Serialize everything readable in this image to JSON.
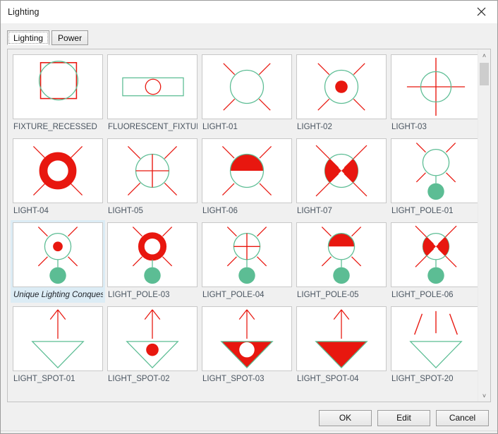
{
  "window": {
    "title": "Lighting",
    "close_icon": "close-icon"
  },
  "tabs": [
    {
      "label": "Lighting",
      "active": true
    },
    {
      "label": "Power",
      "active": false
    }
  ],
  "blocks": [
    {
      "name": "FIXTURE_RECESSED",
      "icon": "recessed-fixture-icon",
      "selected": false
    },
    {
      "name": "FLUORESCENT_FIXTUR",
      "icon": "fluorescent-fixture-icon",
      "selected": false
    },
    {
      "name": "LIGHT-01",
      "icon": "light-circle-rays-icon",
      "selected": false
    },
    {
      "name": "LIGHT-02",
      "icon": "light-circle-rays-dot-icon",
      "selected": false
    },
    {
      "name": "LIGHT-03",
      "icon": "light-circle-crosshair-icon",
      "selected": false
    },
    {
      "name": "LIGHT-04",
      "icon": "light-ring-rays-icon",
      "selected": false
    },
    {
      "name": "LIGHT-05",
      "icon": "light-circle-cross-rays-icon",
      "selected": false
    },
    {
      "name": "LIGHT-06",
      "icon": "light-half-filled-rays-icon",
      "selected": false
    },
    {
      "name": "LIGHT-07",
      "icon": "light-bowtie-rays-icon",
      "selected": false
    },
    {
      "name": "LIGHT_POLE-01",
      "icon": "pole-circle-rays-icon",
      "selected": false
    },
    {
      "name": "Unique Lighting Conquest",
      "icon": "pole-circle-dot-rays-icon",
      "selected": true
    },
    {
      "name": "LIGHT_POLE-03",
      "icon": "pole-ring-rays-icon",
      "selected": false
    },
    {
      "name": "LIGHT_POLE-04",
      "icon": "pole-cross-rays-icon",
      "selected": false
    },
    {
      "name": "LIGHT_POLE-05",
      "icon": "pole-half-filled-rays-icon",
      "selected": false
    },
    {
      "name": "LIGHT_POLE-06",
      "icon": "pole-bowtie-rays-icon",
      "selected": false
    },
    {
      "name": "LIGHT_SPOT-01",
      "icon": "spot-triangle-arrow-icon",
      "selected": false
    },
    {
      "name": "LIGHT_SPOT-02",
      "icon": "spot-triangle-arrow-dot-icon",
      "selected": false
    },
    {
      "name": "LIGHT_SPOT-03",
      "icon": "spot-triangle-filled-hole-icon",
      "selected": false
    },
    {
      "name": "LIGHT_SPOT-04",
      "icon": "spot-triangle-filled-icon",
      "selected": false
    },
    {
      "name": "LIGHT_SPOT-20",
      "icon": "spot-triangle-three-rays-icon",
      "selected": false
    }
  ],
  "scrollbar": {
    "up_arrow": "˄",
    "down_arrow": "˅"
  },
  "footer": {
    "ok_label": "OK",
    "edit_label": "Edit",
    "cancel_label": "Cancel"
  },
  "colors": {
    "red": "#e8170f",
    "teal": "#5cbd94",
    "selection": "#dcecf5",
    "tile_border": "#c8c8c8"
  }
}
